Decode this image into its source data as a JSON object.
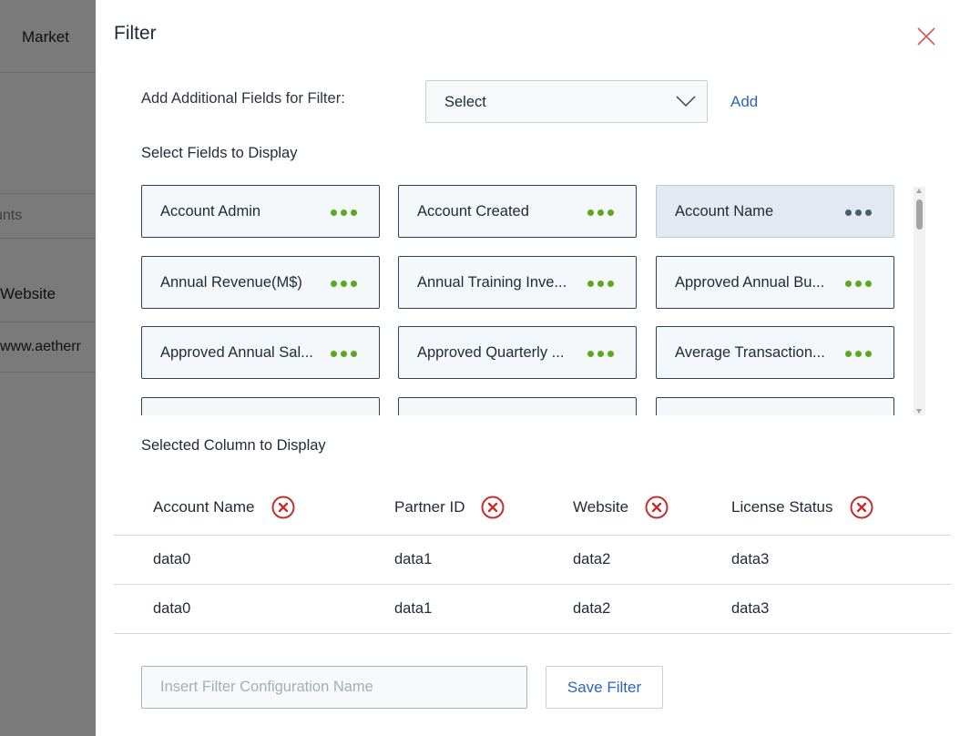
{
  "background": {
    "nav_item": "Market",
    "accounts_fragment": "unts",
    "column_header": "Website",
    "cell_value": "www.aetherr"
  },
  "drawer": {
    "title": "Filter",
    "close_icon": "close-icon",
    "add_fields_label": "Add Additional Fields for Filter:",
    "select_value": "Select",
    "add_link": "Add",
    "select_fields_label": "Select Fields to Display",
    "field_chips": [
      {
        "label": "Account Admin",
        "active": false
      },
      {
        "label": "Account Created",
        "active": false
      },
      {
        "label": "Account Name",
        "active": true
      },
      {
        "label": "Annual Revenue(M$)",
        "active": false
      },
      {
        "label": "Annual Training Inve...",
        "active": false
      },
      {
        "label": "Approved Annual Bu...",
        "active": false
      },
      {
        "label": "Approved Annual Sal...",
        "active": false
      },
      {
        "label": "Approved Quarterly ...",
        "active": false
      },
      {
        "label": "Average Transaction...",
        "active": false
      },
      {
        "label": "",
        "active": false
      },
      {
        "label": "",
        "active": false
      },
      {
        "label": "",
        "active": false
      }
    ],
    "selected_columns_label": "Selected Column to Display",
    "table": {
      "headers": [
        "Account Name",
        "Partner ID",
        "Website",
        "License Status"
      ],
      "rows": [
        [
          "data0",
          "data1",
          "data2",
          "data3"
        ],
        [
          "data0",
          "data1",
          "data2",
          "data3"
        ]
      ]
    },
    "config_name_placeholder": "Insert Filter Configuration Name",
    "config_name_value": "",
    "save_button": "Save Filter"
  },
  "colors": {
    "link_blue": "#2f65b8",
    "dot_green": "#5aa81e",
    "remove_red": "#c62d2d",
    "close_red": "#d9534f"
  }
}
